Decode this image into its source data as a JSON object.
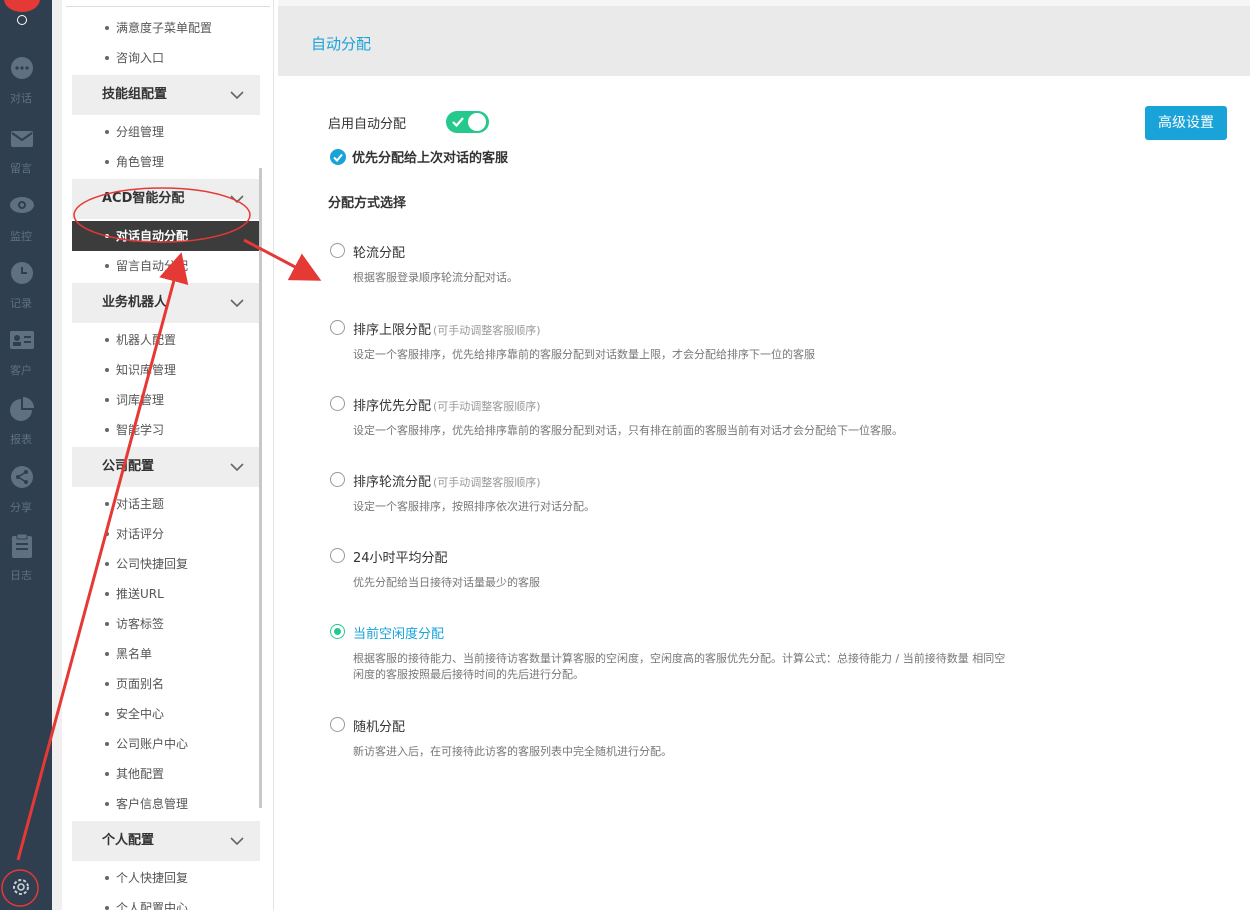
{
  "rail": {
    "items": [
      {
        "icon": "chat-icon",
        "label": "对话"
      },
      {
        "icon": "mail-icon",
        "label": "留言"
      },
      {
        "icon": "eye-icon",
        "label": "监控"
      },
      {
        "icon": "clock-icon",
        "label": "记录"
      },
      {
        "icon": "id-card-icon",
        "label": "客户"
      },
      {
        "icon": "pie-chart-icon",
        "label": "报表"
      },
      {
        "icon": "share-icon",
        "label": "分享"
      },
      {
        "icon": "clipboard-icon",
        "label": "日志"
      }
    ]
  },
  "menu": {
    "items": [
      {
        "type": "item",
        "label": "满意度子菜单配置"
      },
      {
        "type": "item",
        "label": "咨询入口"
      },
      {
        "type": "group",
        "label": "技能组配置"
      },
      {
        "type": "item",
        "label": "分组管理"
      },
      {
        "type": "item",
        "label": "角色管理"
      },
      {
        "type": "group",
        "label": "ACD智能分配"
      },
      {
        "type": "item",
        "label": "对话自动分配",
        "active": true
      },
      {
        "type": "item",
        "label": "留言自动分配"
      },
      {
        "type": "group",
        "label": "业务机器人"
      },
      {
        "type": "item",
        "label": "机器人配置"
      },
      {
        "type": "item",
        "label": "知识库管理"
      },
      {
        "type": "item",
        "label": "词库管理"
      },
      {
        "type": "item",
        "label": "智能学习"
      },
      {
        "type": "group",
        "label": "公司配置"
      },
      {
        "type": "item",
        "label": "对话主题"
      },
      {
        "type": "item",
        "label": "对话评分"
      },
      {
        "type": "item",
        "label": "公司快捷回复"
      },
      {
        "type": "item",
        "label": "推送URL"
      },
      {
        "type": "item",
        "label": "访客标签"
      },
      {
        "type": "item",
        "label": "黑名单"
      },
      {
        "type": "item",
        "label": "页面别名"
      },
      {
        "type": "item",
        "label": "安全中心"
      },
      {
        "type": "item",
        "label": "公司账户中心"
      },
      {
        "type": "item",
        "label": "其他配置"
      },
      {
        "type": "item",
        "label": "客户信息管理"
      },
      {
        "type": "group",
        "label": "个人配置"
      },
      {
        "type": "item",
        "label": "个人快捷回复"
      },
      {
        "type": "item",
        "label": "个人配置中心"
      }
    ]
  },
  "header": {
    "title": "自动分配"
  },
  "settings": {
    "enable_label": "启用自动分配",
    "enable_on": true,
    "advanced_button": "高级设置",
    "prefer_last": "优先分配给上次对话的客服",
    "section_title": "分配方式选择"
  },
  "options": [
    {
      "name": "轮流分配",
      "hint": "",
      "desc": "根据客服登录顺序轮流分配对话。",
      "selected": false
    },
    {
      "name": "排序上限分配",
      "hint": "(可手动调整客服顺序)",
      "desc": "设定一个客服排序，优先给排序靠前的客服分配到对话数量上限，才会分配给排序下一位的客服",
      "selected": false
    },
    {
      "name": "排序优先分配",
      "hint": "(可手动调整客服顺序)",
      "desc": "设定一个客服排序，优先给排序靠前的客服分配到对话，只有排在前面的客服当前有对话才会分配给下一位客服。",
      "selected": false
    },
    {
      "name": "排序轮流分配",
      "hint": "(可手动调整客服顺序)",
      "desc": "设定一个客服排序，按照排序依次进行对话分配。",
      "selected": false
    },
    {
      "name": "24小时平均分配",
      "hint": "",
      "desc": "优先分配给当日接待对话量最少的客服",
      "selected": false
    },
    {
      "name": "当前空闲度分配",
      "hint": "",
      "desc": "根据客服的接待能力、当前接待访客数量计算客服的空闲度，空闲度高的客服优先分配。计算公式：总接待能力 / 当前接待数量 相同空闲度的客服按照最后接待时间的先后进行分配。",
      "selected": true
    },
    {
      "name": "随机分配",
      "hint": "",
      "desc": "新访客进入后，在可接待此访客的客服列表中完全随机进行分配。",
      "selected": false
    }
  ],
  "colors": {
    "accent": "#1aa3d9",
    "toggle": "#25c98e",
    "rail": "#2f3f4f",
    "annotation": "#e53935"
  }
}
